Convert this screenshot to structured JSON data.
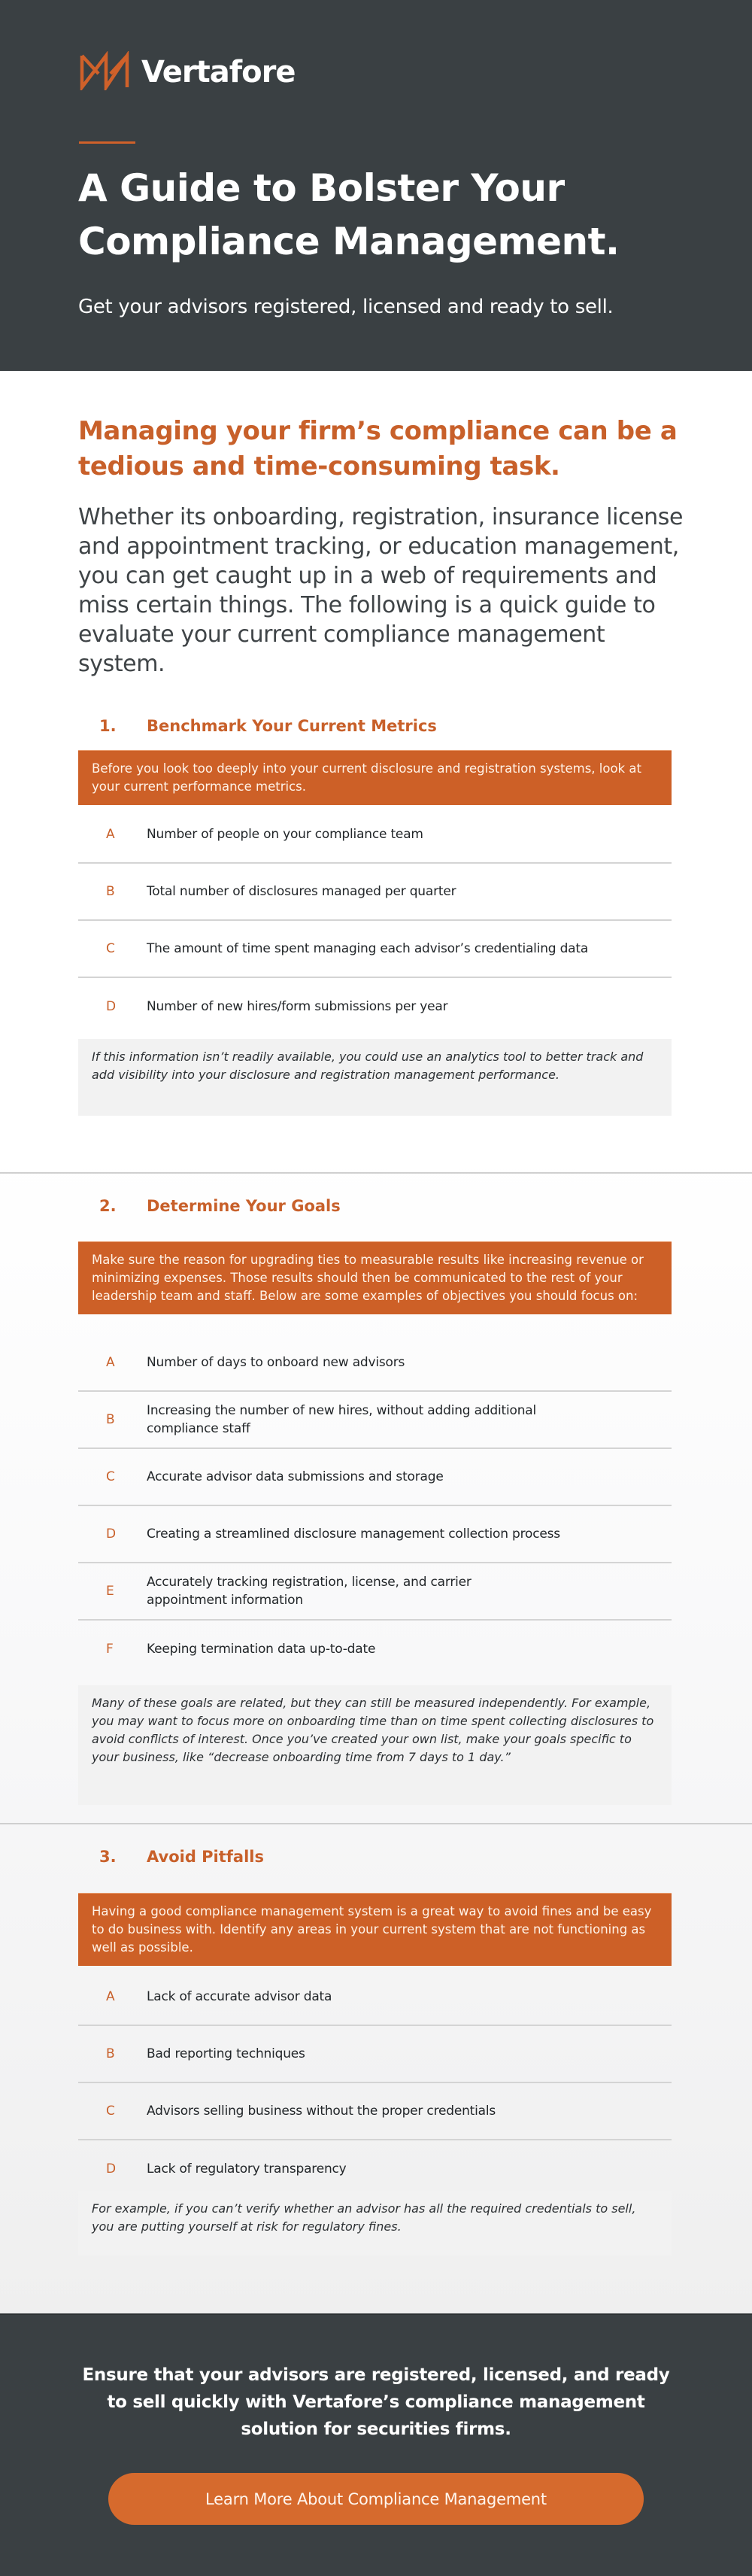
{
  "header": {
    "logo_icon": "vertafore-bowtie-icon",
    "brand_name": "Vertafore",
    "title": "A Guide to Bolster Your Compliance Management.",
    "subtitle": "Get your advisors registered, licensed and ready to sell."
  },
  "intro": {
    "heading": "Managing your firm’s compliance can be a tedious and time-consuming task.",
    "body": "Whether its onboarding, registration, insurance license and appointment tracking, or education management, you can get caught up in a web of requirements and miss certain things. The following is a quick guide to evaluate your current compliance management system."
  },
  "sections": [
    {
      "number": "1.",
      "title": "Benchmark Your Current Metrics",
      "callout": "Before you look too deeply into your current disclosure and registration systems, look at your current performance metrics.",
      "items": [
        {
          "letter": "A",
          "text": "Number of people on your compliance team"
        },
        {
          "letter": "B",
          "text": "Total number of disclosures managed per quarter"
        },
        {
          "letter": "C",
          "text": "The amount of time spent managing each advisor’s credentialing data"
        },
        {
          "letter": "D",
          "text": "Number of new hires/form submissions per year"
        }
      ],
      "note": "If this information isn’t readily available, you could use an analytics tool to better track and add visibility into your disclosure and registration management performance."
    },
    {
      "number": "2.",
      "title": "Determine Your Goals",
      "callout": "Make sure the reason for upgrading ties to measurable results like increasing revenue or minimizing expenses. Those results should then be communicated to the rest of your leadership team and staff. Below are some examples of objectives you should focus on:",
      "items": [
        {
          "letter": "A",
          "text": "Number of days to onboard new advisors"
        },
        {
          "letter": "B",
          "text": "Increasing the number of new hires, without adding additional compliance staff"
        },
        {
          "letter": "C",
          "text": "Accurate advisor data submissions and storage"
        },
        {
          "letter": "D",
          "text": "Creating a streamlined disclosure management collection process"
        },
        {
          "letter": "E",
          "text": "Accurately tracking registration, license, and carrier appointment information"
        },
        {
          "letter": "F",
          "text": "Keeping termination data up-to-date"
        }
      ],
      "note": "Many of these goals are related, but they can still be measured independently. For example, you may want to focus more on onboarding time than on time spent collecting disclosures to avoid conflicts of interest. Once you’ve created your own list, make your goals specific to your business, like “decrease onboarding time from 7 days to 1 day.”"
    },
    {
      "number": "3.",
      "title": "Avoid Pitfalls",
      "callout": "Having a good compliance management system is a great way to avoid fines and be easy to do business with. Identify any areas in your current system that are not functioning as well as possible.",
      "items": [
        {
          "letter": "A",
          "text": "Lack of accurate advisor data"
        },
        {
          "letter": "B",
          "text": "Bad reporting techniques"
        },
        {
          "letter": "C",
          "text": "Advisors selling business without the proper credentials"
        },
        {
          "letter": "D",
          "text": "Lack of regulatory transparency"
        }
      ],
      "note": "For example, if you can’t verify whether an advisor has all the required credentials to sell, you are putting yourself at risk for regulatory fines."
    }
  ],
  "footer": {
    "message": "Ensure that your advisors are registered, licensed, and ready to sell quickly with Vertafore’s compliance management solution for securities firms.",
    "cta_label": "Learn More About Compliance Management"
  },
  "colors": {
    "accent": "#cd6027",
    "dark": "#3a4043",
    "note_bg": "#f2f2f2"
  }
}
